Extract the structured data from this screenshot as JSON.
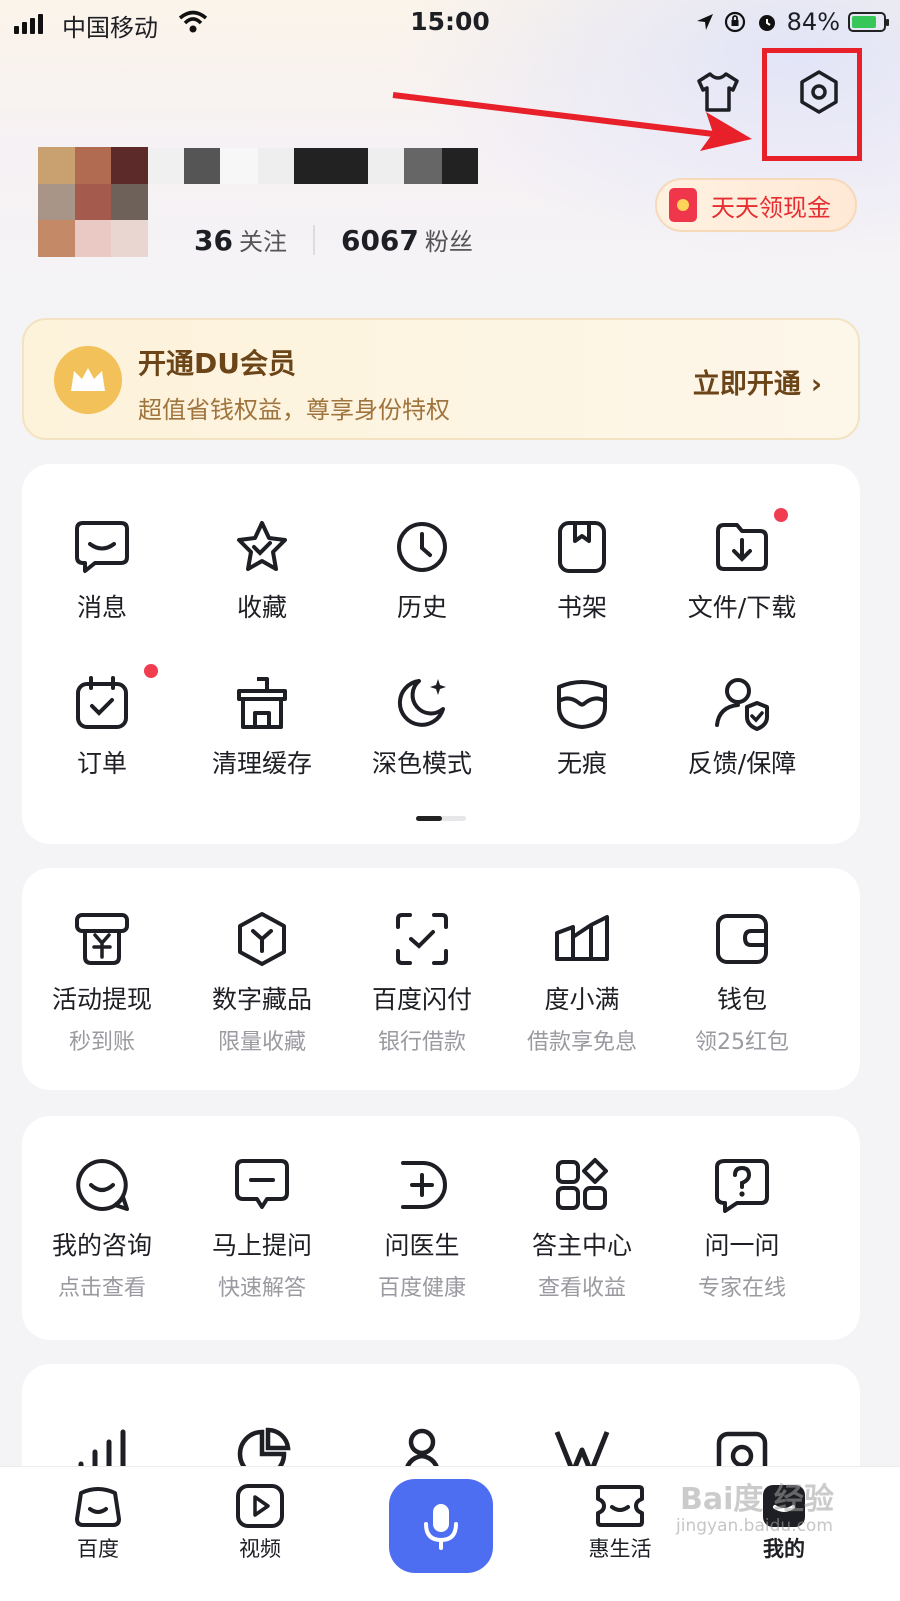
{
  "status_bar": {
    "carrier": "中国移动",
    "time": "15:00",
    "battery": "84%"
  },
  "profile": {
    "following_count": "36",
    "following_label": "关注",
    "followers_count": "6067",
    "followers_label": "粉丝",
    "cash_button": "天天领现金"
  },
  "vip": {
    "title": "开通DU会员",
    "subtitle": "超值省钱权益，尊享身份特权",
    "button": "立即开通"
  },
  "tools": [
    {
      "label": "消息",
      "icon": "message-icon"
    },
    {
      "label": "收藏",
      "icon": "star-icon"
    },
    {
      "label": "历史",
      "icon": "clock-icon"
    },
    {
      "label": "书架",
      "icon": "bookmark-icon"
    },
    {
      "label": "文件/下载",
      "icon": "download-folder-icon",
      "badge": true
    },
    {
      "label": "订单",
      "icon": "order-calendar-icon",
      "badge": true
    },
    {
      "label": "清理缓存",
      "icon": "clean-icon"
    },
    {
      "label": "深色模式",
      "icon": "moon-icon"
    },
    {
      "label": "无痕",
      "icon": "mask-icon"
    },
    {
      "label": "反馈/保障",
      "icon": "user-shield-icon"
    }
  ],
  "finance": [
    {
      "label": "活动提现",
      "sub": "秒到账",
      "icon": "cash-withdraw-icon"
    },
    {
      "label": "数字藏品",
      "sub": "限量收藏",
      "icon": "hexagon-icon"
    },
    {
      "label": "百度闪付",
      "sub": "银行借款",
      "icon": "scan-check-icon"
    },
    {
      "label": "度小满",
      "sub": "借款享免息",
      "icon": "duxiaoman-icon"
    },
    {
      "label": "钱包",
      "sub": "领25红包",
      "icon": "wallet-icon"
    }
  ],
  "health": [
    {
      "label": "我的咨询",
      "sub": "点击查看",
      "icon": "consult-icon"
    },
    {
      "label": "马上提问",
      "sub": "快速解答",
      "icon": "ask-icon"
    },
    {
      "label": "问医生",
      "sub": "百度健康",
      "icon": "doctor-icon"
    },
    {
      "label": "答主中心",
      "sub": "查看收益",
      "icon": "apps-icon"
    },
    {
      "label": "问一问",
      "sub": "专家在线",
      "icon": "question-icon"
    }
  ],
  "tabbar": {
    "home": "百度",
    "video": "视频",
    "life": "惠生活",
    "mine": "我的"
  },
  "watermark": {
    "text": "Bai度 经验",
    "url": "jingyan.baidu.com"
  }
}
